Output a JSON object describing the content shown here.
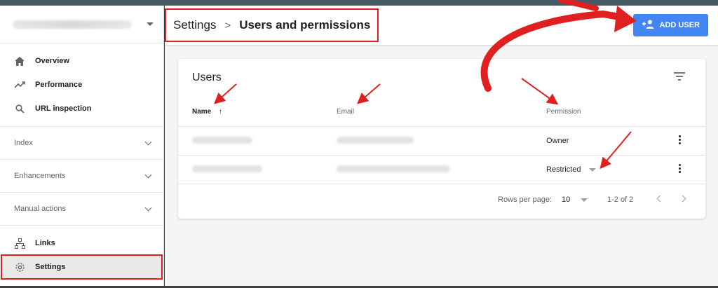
{
  "sidebar": {
    "nav": [
      {
        "label": "Overview",
        "icon": "home-icon"
      },
      {
        "label": "Performance",
        "icon": "trending-up-icon"
      },
      {
        "label": "URL inspection",
        "icon": "search-icon"
      }
    ],
    "sections": [
      {
        "label": "Index"
      },
      {
        "label": "Enhancements"
      },
      {
        "label": "Manual actions"
      }
    ],
    "bottom": [
      {
        "label": "Links",
        "icon": "links-icon"
      },
      {
        "label": "Settings",
        "icon": "gear-icon"
      }
    ]
  },
  "header": {
    "breadcrumb_root": "Settings",
    "breadcrumb_separator": ">",
    "breadcrumb_current": "Users and permissions",
    "add_user_label": "ADD USER"
  },
  "users_card": {
    "title": "Users",
    "columns": {
      "name": "Name",
      "sort_arrow": "↑",
      "email": "Email",
      "permission": "Permission"
    },
    "rows": [
      {
        "permission": "Owner"
      },
      {
        "permission": "Restricted"
      }
    ],
    "footer": {
      "rows_per_page_label": "Rows per page:",
      "rows_per_page_value": "10",
      "range": "1-2 of 2"
    }
  },
  "colors": {
    "accent": "#4285f4",
    "annotation": "#e02020"
  }
}
